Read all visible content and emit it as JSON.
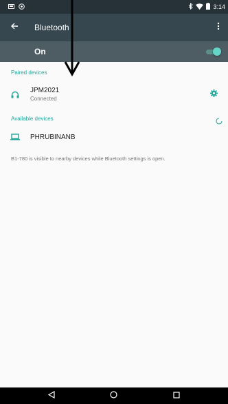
{
  "status_bar": {
    "time": "3:14",
    "left_icons": [
      "notification-icon",
      "alert-icon"
    ],
    "right_icons": [
      "bluetooth-icon",
      "wifi-icon",
      "battery-icon"
    ]
  },
  "app_bar": {
    "title": "Bluetooth",
    "back_icon": "arrow-back-icon",
    "overflow_icon": "more-vert-icon"
  },
  "bluetooth_switch": {
    "label": "On",
    "enabled": true
  },
  "paired_devices": {
    "header": "Paired devices",
    "items": [
      {
        "name": "JPM2021",
        "status": "Connected",
        "icon": "headphones-icon",
        "action_icon": "gear-icon"
      }
    ]
  },
  "available_devices": {
    "header": "Available devices",
    "scanning": true,
    "items": [
      {
        "name": "PHRUBINANB",
        "icon": "laptop-icon"
      }
    ]
  },
  "visibility_message": "B1-780 is visible to nearby devices while Bluetooth settings is open.",
  "nav_bar": {
    "buttons": [
      "back-triangle-icon",
      "home-circle-icon",
      "recents-square-icon"
    ]
  },
  "colors": {
    "status_bar": "#263238",
    "app_bar": "#37474f",
    "switch_bar": "#4e5d64",
    "accent": "#26a69a",
    "toggle_thumb": "#64d6c8"
  }
}
